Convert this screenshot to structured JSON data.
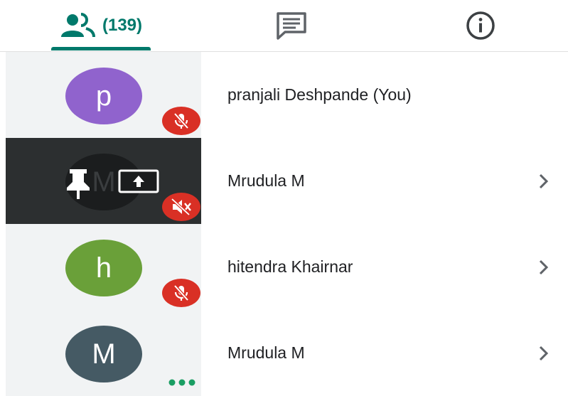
{
  "tabs": {
    "people_count": "(139)",
    "accent": "#00796b"
  },
  "participants": [
    {
      "initial": "p",
      "name": "pranjali Deshpande (You)",
      "avatar_color": "#9063cd",
      "muted": true,
      "has_chevron": false,
      "hovered": false
    },
    {
      "initial": "M",
      "name": "Mrudula M",
      "avatar_color": "#1b1d1e",
      "muted": true,
      "has_chevron": true,
      "hovered": true
    },
    {
      "initial": "h",
      "name": "hitendra Khairnar",
      "avatar_color": "#6aa039",
      "muted": true,
      "has_chevron": true,
      "hovered": false
    },
    {
      "initial": "M",
      "name": "Mrudula M",
      "avatar_color": "#455a64",
      "muted": false,
      "speaking": true,
      "has_chevron": true,
      "hovered": false
    }
  ],
  "icons": [
    "people-icon",
    "chat-icon",
    "info-icon",
    "mic-off-icon",
    "pin-icon",
    "present-icon",
    "chevron-right-icon",
    "more-dots-icon"
  ]
}
